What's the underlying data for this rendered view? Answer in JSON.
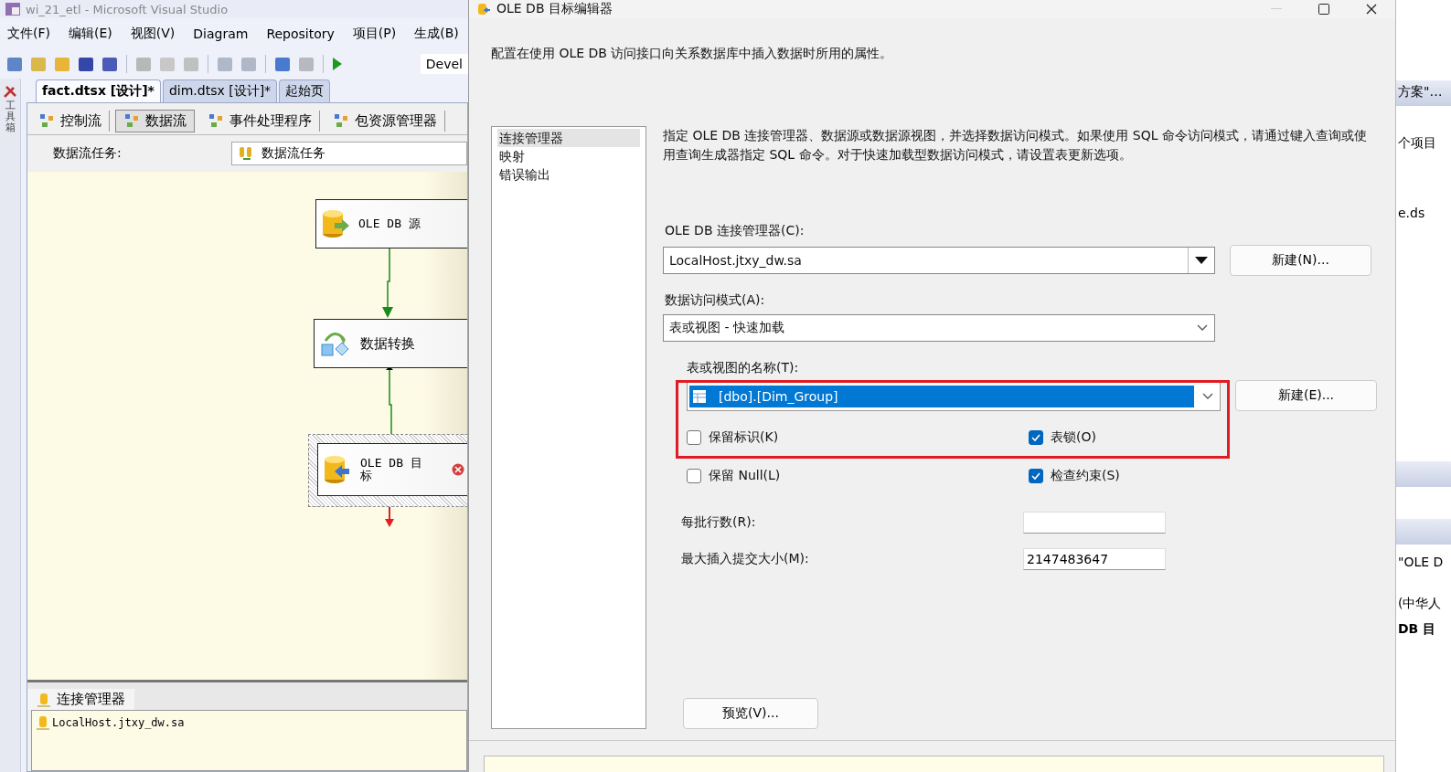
{
  "window": {
    "title": "wi_21_etl - Microsoft Visual Studio"
  },
  "menu": [
    "文件(F)",
    "编辑(E)",
    "视图(V)",
    "Diagram",
    "Repository",
    "项目(P)",
    "生成(B)"
  ],
  "toolbar": {
    "config_combo": "Devel"
  },
  "toolbox": {
    "label": "工具箱"
  },
  "document_tabs": [
    {
      "label": "fact.dtsx [设计]*",
      "selected": true
    },
    {
      "label": "dim.dtsx [设计]*",
      "selected": false
    },
    {
      "label": "起始页",
      "selected": false
    }
  ],
  "designer_tabs": [
    {
      "label": "控制流",
      "selected": false
    },
    {
      "label": "数据流",
      "selected": true
    },
    {
      "label": "事件处理程序",
      "selected": false
    },
    {
      "label": "包资源管理器",
      "selected": false
    }
  ],
  "task": {
    "label": "数据流任务:",
    "value": "数据流任务"
  },
  "diagram": {
    "nodes": [
      {
        "label": "OLE DB 源",
        "kind": "source",
        "selected": false,
        "error": false
      },
      {
        "label": "数据转换",
        "kind": "transform",
        "selected": false,
        "error": false
      },
      {
        "label": "OLE DB 目标",
        "kind": "destination",
        "selected": true,
        "error": true
      }
    ]
  },
  "connection_managers": {
    "tab": "连接管理器",
    "items": [
      "LocalHost.jtxy_dw.sa"
    ]
  },
  "side_panel": {
    "texts": [
      "方案\"…",
      "个项目",
      "e.ds",
      "\"OLE D",
      "(中华人",
      "DB 目"
    ]
  },
  "dialog": {
    "title": "OLE DB 目标编辑器",
    "description": "配置在使用 OLE DB 访问接口向关系数据库中插入数据时所用的属性。",
    "pages": [
      {
        "label": "连接管理器",
        "selected": true
      },
      {
        "label": "映射",
        "selected": false
      },
      {
        "label": "错误输出",
        "selected": false
      }
    ],
    "page_description": "指定 OLE DB 连接管理器、数据源或数据源视图，并选择数据访问模式。如果使用 SQL 命令访问模式，请通过键入查询或使用查询生成器指定 SQL 命令。对于快速加载型数据访问模式，请设置表更新选项。",
    "connection_label": "OLE DB 连接管理器(C):",
    "connection_value": "LocalHost.jtxy_dw.sa",
    "new_connection_button": "新建(N)...",
    "access_mode_label": "数据访问模式(A):",
    "access_mode_value": "表或视图 - 快速加载",
    "table_label": "表或视图的名称(T):",
    "table_value": "[dbo].[Dim_Group]",
    "table_highlighted": true,
    "new_table_button": "新建(E)...",
    "options": [
      {
        "label": "保留标识(K)",
        "checked": false
      },
      {
        "label": "表锁(O)",
        "checked": true
      },
      {
        "label": "保留 Null(L)",
        "checked": false
      },
      {
        "label": "检查约束(S)",
        "checked": true
      }
    ],
    "fields": [
      {
        "label": "每批行数(R):"
      },
      {
        "label": "最大插入提交大小(M):",
        "value": "2147483647"
      }
    ],
    "preview_button": "预览(V)..."
  }
}
